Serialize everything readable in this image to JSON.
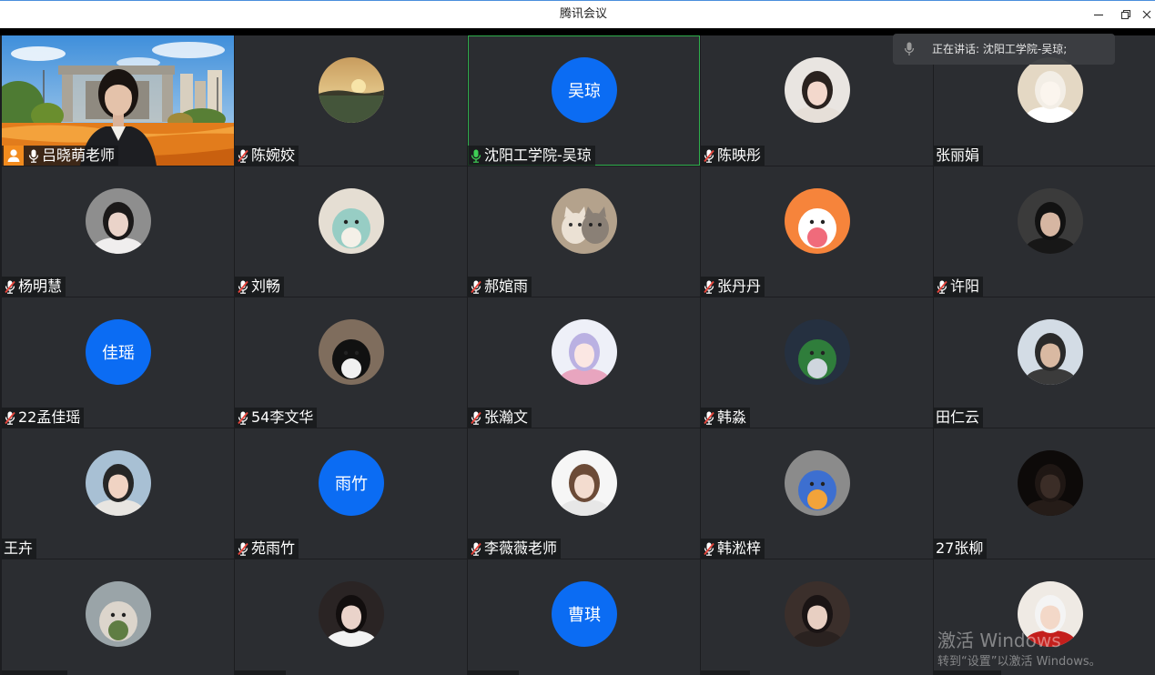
{
  "window": {
    "title": "腾讯会议",
    "controls": [
      {
        "name": "minimize",
        "icon": "minimize-icon"
      },
      {
        "name": "restore",
        "icon": "restore-icon"
      },
      {
        "name": "close",
        "icon": "close-icon"
      }
    ]
  },
  "speaking_banner": {
    "icon": "microphone-icon",
    "text": "正在讲话: 沈阳工学院-吴琼;"
  },
  "colors": {
    "avatar_blue": "#0b6cf3",
    "active_speaker_border": "#2fae4c",
    "speaking_mic": "#3fcf55",
    "muted_slash": "#e8453c",
    "host_badge": "#f28b1e",
    "tile_bg": "#2b2d31"
  },
  "participants": [
    {
      "name": "吕晓萌老师",
      "mic": "on",
      "host": true,
      "avatar": {
        "type": "video"
      }
    },
    {
      "name": "陈婉姣",
      "mic": "muted",
      "avatar": {
        "type": "photo",
        "style": "landscape",
        "palette": [
          "#c89c5e",
          "#f7e4a8",
          "#44553a"
        ]
      }
    },
    {
      "name": "沈阳工学院-吴琼",
      "mic": "speaking",
      "active": true,
      "avatar": {
        "type": "text",
        "text": "吴琼"
      }
    },
    {
      "name": "陈映彤",
      "mic": "muted",
      "avatar": {
        "type": "photo",
        "style": "portrait",
        "palette": [
          "#e9e5e1",
          "#2a221f",
          "#f3d8cc",
          "#e6dfd8"
        ]
      }
    },
    {
      "name": "张丽娟",
      "mic": "none",
      "avatar": {
        "type": "photo",
        "style": "portrait",
        "palette": [
          "#e4d8c4",
          "#f3eee6",
          "#fbf5ee",
          "#ffffff"
        ]
      }
    },
    {
      "name": "杨明慧",
      "mic": "muted",
      "avatar": {
        "type": "photo",
        "style": "portrait",
        "palette": [
          "#8e8e8e",
          "#1b1919",
          "#ead3c9",
          "#f0eeee"
        ]
      }
    },
    {
      "name": "刘畅",
      "mic": "muted",
      "avatar": {
        "type": "photo",
        "style": "figure",
        "palette": [
          "#e5ded3",
          "#97cdc4",
          "#f4f0e8"
        ]
      }
    },
    {
      "name": "郝婠雨",
      "mic": "muted",
      "avatar": {
        "type": "photo",
        "style": "pair",
        "palette": [
          "#b4a28c",
          "#ebe1d4",
          "#8a8076"
        ]
      }
    },
    {
      "name": "张丹丹",
      "mic": "muted",
      "avatar": {
        "type": "photo",
        "style": "figure",
        "palette": [
          "#f6843b",
          "#ffffff",
          "#f06b7b"
        ]
      }
    },
    {
      "name": "许阳",
      "mic": "muted",
      "avatar": {
        "type": "photo",
        "style": "portrait",
        "palette": [
          "#3b3b3b",
          "#121212",
          "#d6b6a2",
          "#171717"
        ]
      }
    },
    {
      "name": "22孟佳瑶",
      "mic": "muted",
      "avatar": {
        "type": "text",
        "text": "佳瑶"
      }
    },
    {
      "name": "54李文华",
      "mic": "muted",
      "avatar": {
        "type": "photo",
        "style": "figure",
        "palette": [
          "#7f6d5d",
          "#111111",
          "#f1f1f1"
        ]
      }
    },
    {
      "name": "张瀚文",
      "mic": "muted",
      "avatar": {
        "type": "photo",
        "style": "portrait",
        "palette": [
          "#eef0f8",
          "#bab1e2",
          "#fbe7e3",
          "#e8a5bf"
        ]
      }
    },
    {
      "name": "韩淼",
      "mic": "muted",
      "avatar": {
        "type": "photo",
        "style": "figure",
        "palette": [
          "#253040",
          "#2f7d3b",
          "#cfd6de"
        ]
      }
    },
    {
      "name": "田仁云",
      "mic": "none",
      "avatar": {
        "type": "photo",
        "style": "portrait",
        "palette": [
          "#d3dce5",
          "#2a2a2a",
          "#d9b9a2",
          "#3b3b3b"
        ]
      }
    },
    {
      "name": "王卉",
      "mic": "none",
      "avatar": {
        "type": "photo",
        "style": "portrait",
        "palette": [
          "#a8c0d4",
          "#262626",
          "#f0d3c3",
          "#e8e5e1"
        ]
      }
    },
    {
      "name": "苑雨竹",
      "mic": "muted",
      "avatar": {
        "type": "text",
        "text": "雨竹"
      }
    },
    {
      "name": "李薇薇老师",
      "mic": "muted",
      "avatar": {
        "type": "photo",
        "style": "portrait",
        "palette": [
          "#f6f6f6",
          "#6c4b37",
          "#f3dccf",
          "#e7e7e7"
        ]
      }
    },
    {
      "name": "韩淞梓",
      "mic": "muted",
      "avatar": {
        "type": "photo",
        "style": "figure",
        "palette": [
          "#8b8b8b",
          "#3d6fd0",
          "#f2a33a"
        ]
      }
    },
    {
      "name": "27张柳",
      "mic": "none",
      "avatar": {
        "type": "photo",
        "style": "portrait",
        "palette": [
          "#0d0a09",
          "#1f1714",
          "#3b2d27",
          "#251c18"
        ]
      }
    },
    {
      "name": "",
      "mic": null,
      "avatar": {
        "type": "photo",
        "style": "figure",
        "palette": [
          "#9aa4a8",
          "#dcd5cc",
          "#5f7d43"
        ]
      }
    },
    {
      "name": "",
      "mic": null,
      "avatar": {
        "type": "photo",
        "style": "portrait",
        "palette": [
          "#2a2424",
          "#120e0e",
          "#ead3ca",
          "#f2f2f2"
        ]
      }
    },
    {
      "name": "",
      "mic": null,
      "avatar": {
        "type": "text",
        "text": "曹琪"
      }
    },
    {
      "name": "",
      "mic": null,
      "avatar": {
        "type": "photo",
        "style": "portrait",
        "palette": [
          "#3b2f2b",
          "#1a1414",
          "#e8cfc2",
          "#2a2220"
        ]
      }
    },
    {
      "name": "",
      "mic": null,
      "avatar": {
        "type": "photo",
        "style": "portrait",
        "palette": [
          "#efeae4",
          "#f4f4f4",
          "#f3d8c8",
          "#c41f1c"
        ]
      }
    }
  ],
  "watermark": {
    "line1": "激活 Windows",
    "line2": "转到“设置”以激活 Windows。"
  }
}
